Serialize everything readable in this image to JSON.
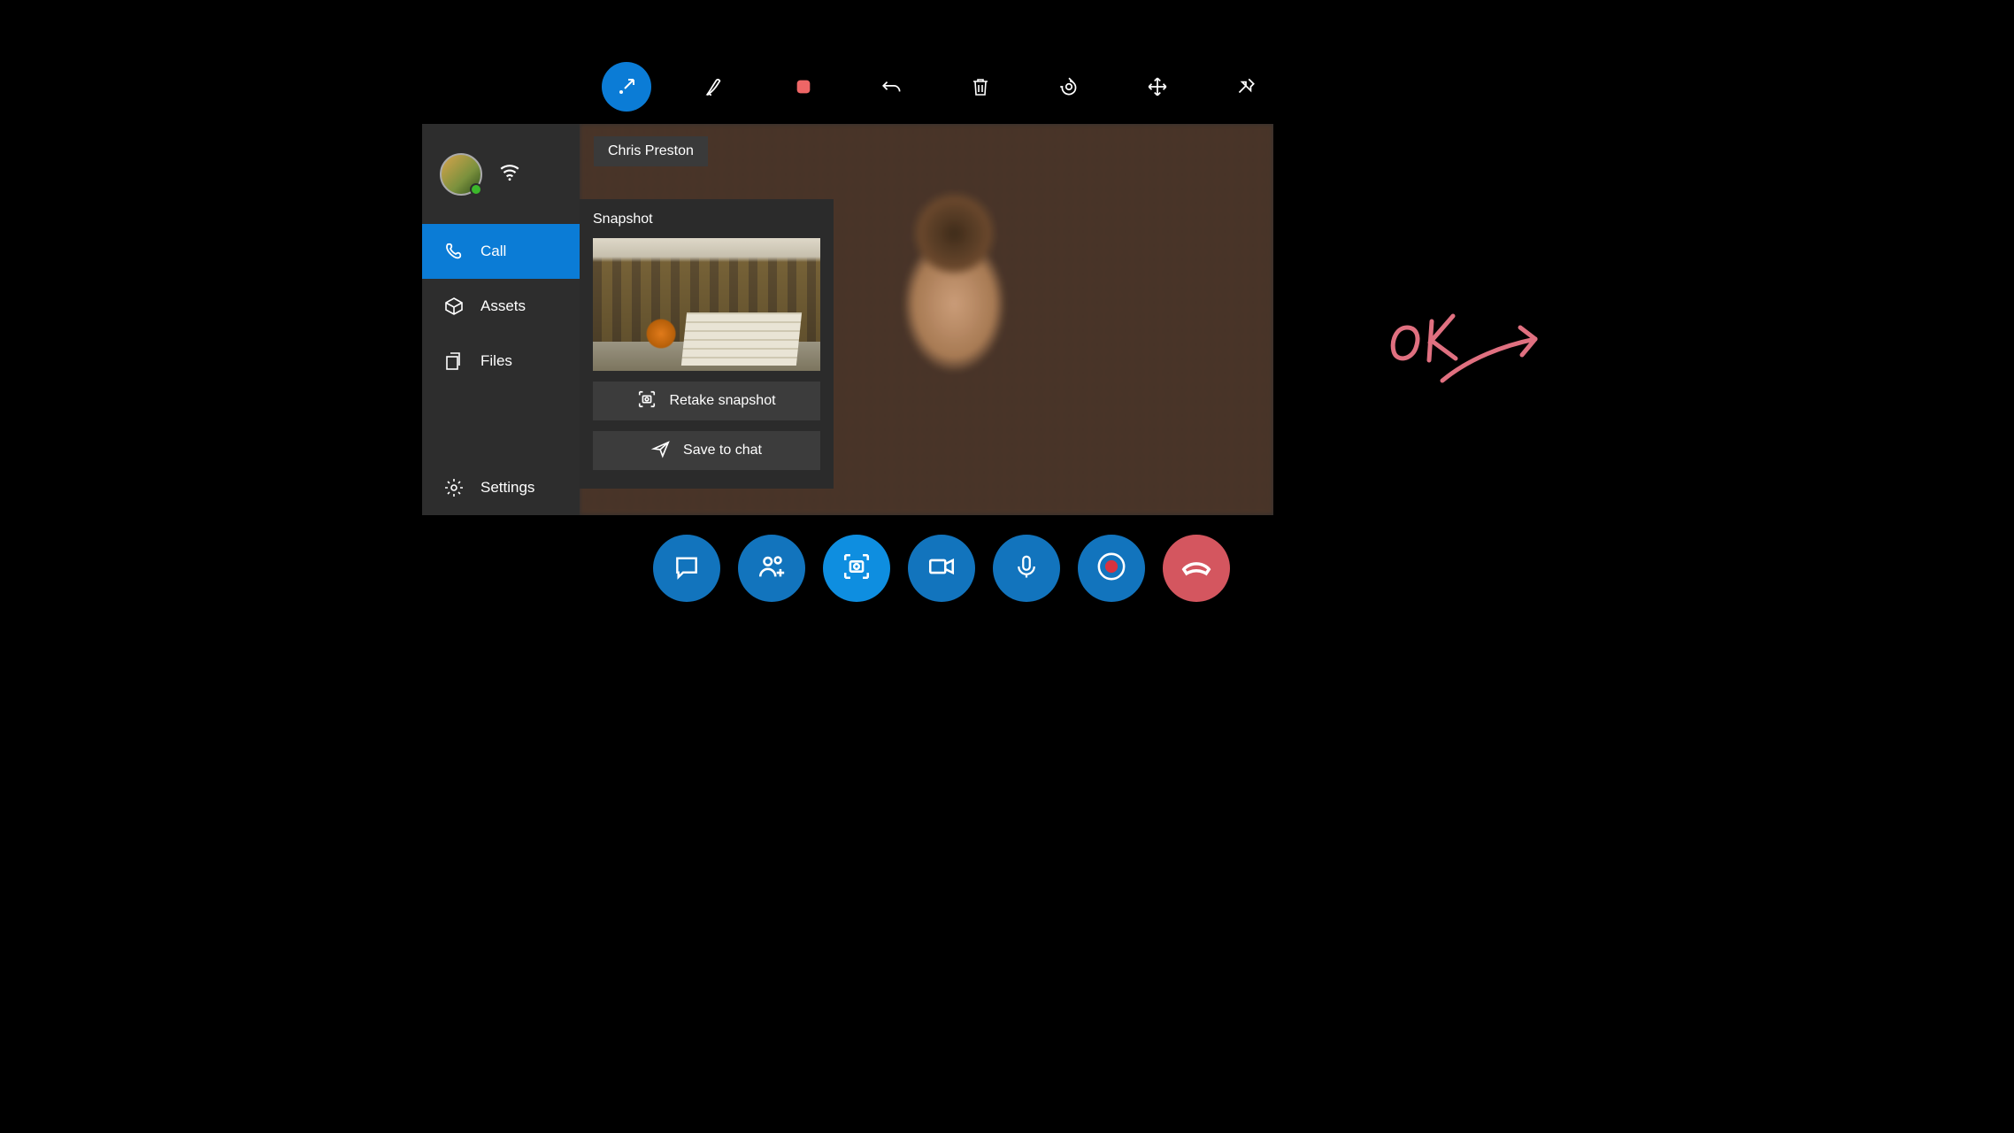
{
  "top_toolbar": {
    "icons": [
      "collapse-icon",
      "pen-icon",
      "stop-icon",
      "undo-icon",
      "trash-icon",
      "target-icon",
      "fullscreen-icon",
      "pin-icon"
    ]
  },
  "sidebar": {
    "items": [
      {
        "label": "Call"
      },
      {
        "label": "Assets"
      },
      {
        "label": "Files"
      }
    ],
    "settings_label": "Settings"
  },
  "caller_name": "Chris Preston",
  "snapshot": {
    "title": "Snapshot",
    "retake_label": "Retake snapshot",
    "save_label": "Save to chat"
  },
  "callbar": {
    "buttons": [
      "chat",
      "add-people",
      "snapshot",
      "video",
      "mic",
      "record",
      "hangup"
    ]
  },
  "annotation": {
    "text": "OK",
    "color": "#e07080"
  }
}
